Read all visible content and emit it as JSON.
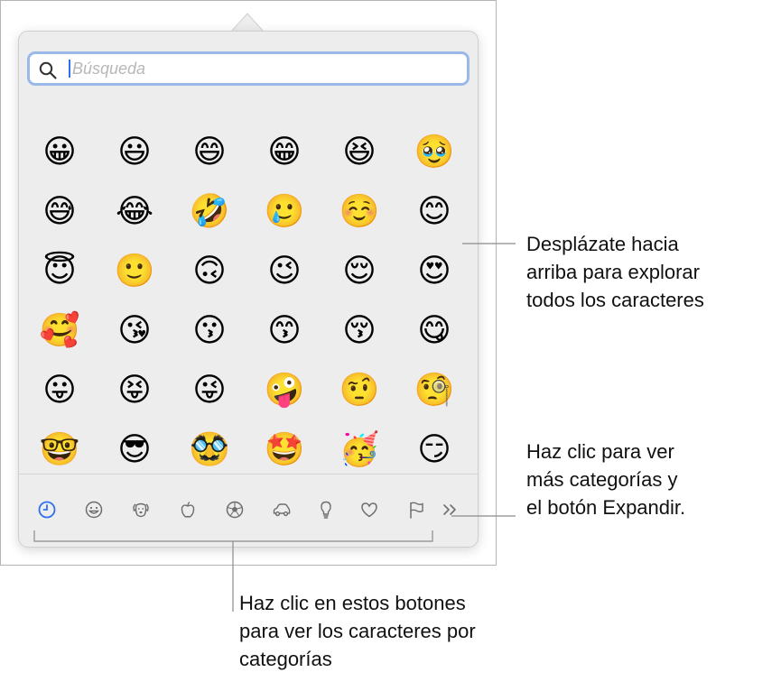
{
  "search": {
    "placeholder": "Búsqueda",
    "icon": "magnifier-icon"
  },
  "emoji_grid": [
    [
      "😀",
      "😃",
      "😄",
      "😁",
      "😆",
      "🥹"
    ],
    [
      "😅",
      "😂",
      "🤣",
      "🥲",
      "☺️",
      "😊"
    ],
    [
      "😇",
      "🙂",
      "🙃",
      "😉",
      "😌",
      "😍"
    ],
    [
      "🥰",
      "😘",
      "😗",
      "😙",
      "😚",
      "😋"
    ],
    [
      "😛",
      "😝",
      "😜",
      "🤪",
      "🤨",
      "🧐"
    ],
    [
      "🤓",
      "😎",
      "🥸",
      "🤩",
      "🥳",
      "😏"
    ]
  ],
  "categories": [
    {
      "name": "recent",
      "icon": "clock-icon",
      "selected": true
    },
    {
      "name": "smileys",
      "icon": "smiley-icon"
    },
    {
      "name": "animals",
      "icon": "dog-icon"
    },
    {
      "name": "food",
      "icon": "apple-icon"
    },
    {
      "name": "activity",
      "icon": "soccer-ball-icon"
    },
    {
      "name": "travel",
      "icon": "car-icon"
    },
    {
      "name": "objects",
      "icon": "lightbulb-icon"
    },
    {
      "name": "symbols",
      "icon": "heart-icon"
    },
    {
      "name": "flags",
      "icon": "flag-icon"
    }
  ],
  "expand_icon": "double-chevron-right-icon",
  "callouts": {
    "scroll": [
      "Desplázate hacia",
      "arriba para explorar",
      "todos los caracteres"
    ],
    "more": [
      "Haz clic para ver",
      "más categorías y",
      "el botón Expandir."
    ],
    "buttons": [
      "Haz clic en estos botones",
      "para ver los caracteres por",
      "categorías"
    ]
  },
  "colors": {
    "accent": "#2e6ff0",
    "focus_ring": "#9bb9e8",
    "icon_gray": "#6e6e6e"
  }
}
